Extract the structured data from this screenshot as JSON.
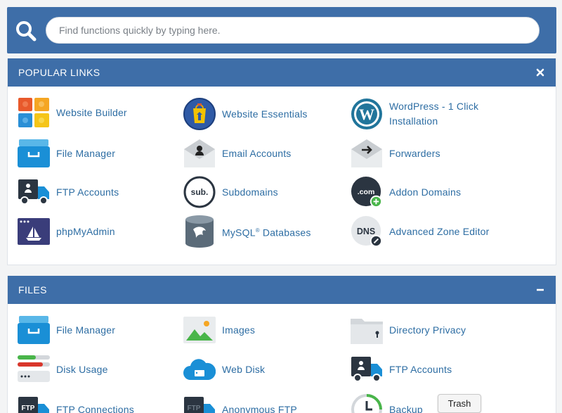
{
  "search": {
    "placeholder": "Find functions quickly by typing here."
  },
  "popular": {
    "title": "POPULAR LINKS",
    "toggle_icon": "close-icon",
    "items": [
      {
        "label": "Website Builder",
        "icon": "website-builder-icon"
      },
      {
        "label": "Website Essentials",
        "icon": "website-essentials-icon"
      },
      {
        "label": "WordPress - 1 Click",
        "label2": "Installation",
        "icon": "wordpress-icon"
      },
      {
        "label": "File Manager",
        "icon": "file-manager-icon"
      },
      {
        "label": "Email Accounts",
        "icon": "email-accounts-icon"
      },
      {
        "label": "Forwarders",
        "icon": "forwarders-icon"
      },
      {
        "label": "FTP Accounts",
        "icon": "ftp-accounts-icon"
      },
      {
        "label": "Subdomains",
        "icon": "subdomains-icon"
      },
      {
        "label": "Addon Domains",
        "icon": "addon-domains-icon"
      },
      {
        "label": "phpMyAdmin",
        "icon": "phpmyadmin-icon"
      },
      {
        "label": "MySQL",
        "label_sup": "®",
        "label_rest": " Databases",
        "icon": "mysql-icon"
      },
      {
        "label": "Advanced Zone Editor",
        "icon": "dns-icon"
      }
    ]
  },
  "files": {
    "title": "FILES",
    "toggle_icon": "minus-icon",
    "items": [
      {
        "label": "File Manager",
        "icon": "file-manager-icon"
      },
      {
        "label": "Images",
        "icon": "images-icon"
      },
      {
        "label": "Directory Privacy",
        "icon": "directory-privacy-icon"
      },
      {
        "label": "Disk Usage",
        "icon": "disk-usage-icon"
      },
      {
        "label": "Web Disk",
        "icon": "web-disk-icon"
      },
      {
        "label": "FTP Accounts",
        "icon": "ftp-accounts-icon"
      },
      {
        "label": "FTP Connections",
        "icon": "ftp-connections-icon"
      },
      {
        "label": "Anonymous FTP",
        "icon": "anonymous-ftp-icon"
      },
      {
        "label": "Backup",
        "icon": "backup-icon"
      }
    ]
  },
  "tooltip": {
    "text": "Trash"
  },
  "colors": {
    "brand_blue": "#3e6ea8",
    "link": "#2d6da3"
  }
}
